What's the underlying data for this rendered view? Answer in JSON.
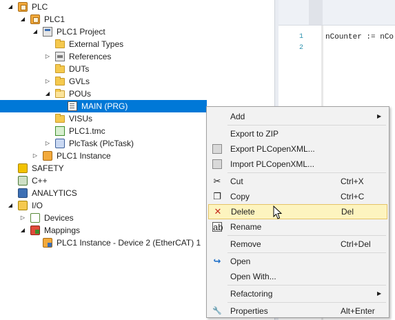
{
  "tree": [
    {
      "label": "PLC",
      "expander": "◢",
      "icon": "plc-icon",
      "level": 0,
      "selected": false
    },
    {
      "label": "PLC1",
      "expander": "◢",
      "icon": "plc-icon",
      "level": 1,
      "selected": false
    },
    {
      "label": "PLC1 Project",
      "expander": "◢",
      "icon": "project-icon",
      "level": 2,
      "selected": false
    },
    {
      "label": "External Types",
      "expander": "",
      "icon": "folder-icon",
      "level": 3,
      "selected": false
    },
    {
      "label": "References",
      "expander": "▷",
      "icon": "references-icon",
      "level": 3,
      "selected": false
    },
    {
      "label": "DUTs",
      "expander": "",
      "icon": "folder-icon",
      "level": 3,
      "selected": false
    },
    {
      "label": "GVLs",
      "expander": "▷",
      "icon": "folder-icon",
      "level": 3,
      "selected": false
    },
    {
      "label": "POUs",
      "expander": "◢",
      "icon": "folder-open-icon",
      "level": 3,
      "selected": false
    },
    {
      "label": "MAIN (PRG)",
      "expander": "",
      "icon": "program-icon",
      "level": 4,
      "selected": true
    },
    {
      "label": "VISUs",
      "expander": "",
      "icon": "folder-icon",
      "level": 3,
      "selected": false
    },
    {
      "label": "PLC1.tmc",
      "expander": "",
      "icon": "tmc-file-icon",
      "level": 3,
      "selected": false
    },
    {
      "label": "PlcTask (PlcTask)",
      "expander": "▷",
      "icon": "task-icon",
      "level": 3,
      "selected": false
    },
    {
      "label": "PLC1 Instance",
      "expander": "▷",
      "icon": "instance-icon",
      "level": 2,
      "selected": false
    },
    {
      "label": "SAFETY",
      "expander": "",
      "icon": "safety-icon",
      "level": 0,
      "selected": false
    },
    {
      "label": "C++",
      "expander": "",
      "icon": "cpp-icon",
      "level": 0,
      "selected": false
    },
    {
      "label": "ANALYTICS",
      "expander": "",
      "icon": "analytics-icon",
      "level": 0,
      "selected": false
    },
    {
      "label": "I/O",
      "expander": "◢",
      "icon": "io-icon",
      "level": 0,
      "selected": false
    },
    {
      "label": "Devices",
      "expander": "▷",
      "icon": "devices-icon",
      "level": 1,
      "selected": false
    },
    {
      "label": "Mappings",
      "expander": "◢",
      "icon": "mappings-icon",
      "level": 1,
      "selected": false
    },
    {
      "label": "PLC1 Instance - Device 2 (EtherCAT) 1",
      "expander": "",
      "icon": "mapping-link-icon",
      "level": 2,
      "selected": false
    }
  ],
  "editor": {
    "line_numbers": [
      "1",
      "2"
    ],
    "code_line": "nCounter := nCo"
  },
  "context_menu": {
    "items": [
      {
        "label": "Add",
        "shortcut": "",
        "submenu": true,
        "icon": "",
        "hover": false
      },
      {
        "sep": true
      },
      {
        "label": "Export to ZIP",
        "shortcut": "",
        "submenu": false,
        "icon": "",
        "hover": false
      },
      {
        "label": "Export PLCopenXML...",
        "shortcut": "",
        "submenu": false,
        "icon": "xml-export-icon",
        "hover": false
      },
      {
        "label": "Import PLCopenXML...",
        "shortcut": "",
        "submenu": false,
        "icon": "xml-import-icon",
        "hover": false
      },
      {
        "sep": true
      },
      {
        "label": "Cut",
        "shortcut": "Ctrl+X",
        "submenu": false,
        "icon": "cut-icon",
        "hover": false
      },
      {
        "label": "Copy",
        "shortcut": "Ctrl+C",
        "submenu": false,
        "icon": "copy-icon",
        "hover": false
      },
      {
        "label": "Delete",
        "shortcut": "Del",
        "submenu": false,
        "icon": "delete-icon",
        "hover": true
      },
      {
        "label": "Rename",
        "shortcut": "",
        "submenu": false,
        "icon": "rename-icon",
        "hover": false
      },
      {
        "sep": true
      },
      {
        "label": "Remove",
        "shortcut": "Ctrl+Del",
        "submenu": false,
        "icon": "",
        "hover": false
      },
      {
        "sep": true
      },
      {
        "label": "Open",
        "shortcut": "",
        "submenu": false,
        "icon": "open-icon",
        "hover": false
      },
      {
        "label": "Open With...",
        "shortcut": "",
        "submenu": false,
        "icon": "",
        "hover": false
      },
      {
        "sep": true
      },
      {
        "label": "Refactoring",
        "shortcut": "",
        "submenu": true,
        "icon": "",
        "hover": false
      },
      {
        "sep": true
      },
      {
        "label": "Properties",
        "shortcut": "Alt+Enter",
        "submenu": false,
        "icon": "wrench-icon",
        "hover": false
      }
    ]
  },
  "colors": {
    "selection": "#0078d7",
    "menu_hover": "#fdf4bf",
    "delete_icon": "#c42b1c",
    "open_icon": "#1e6fc8"
  }
}
